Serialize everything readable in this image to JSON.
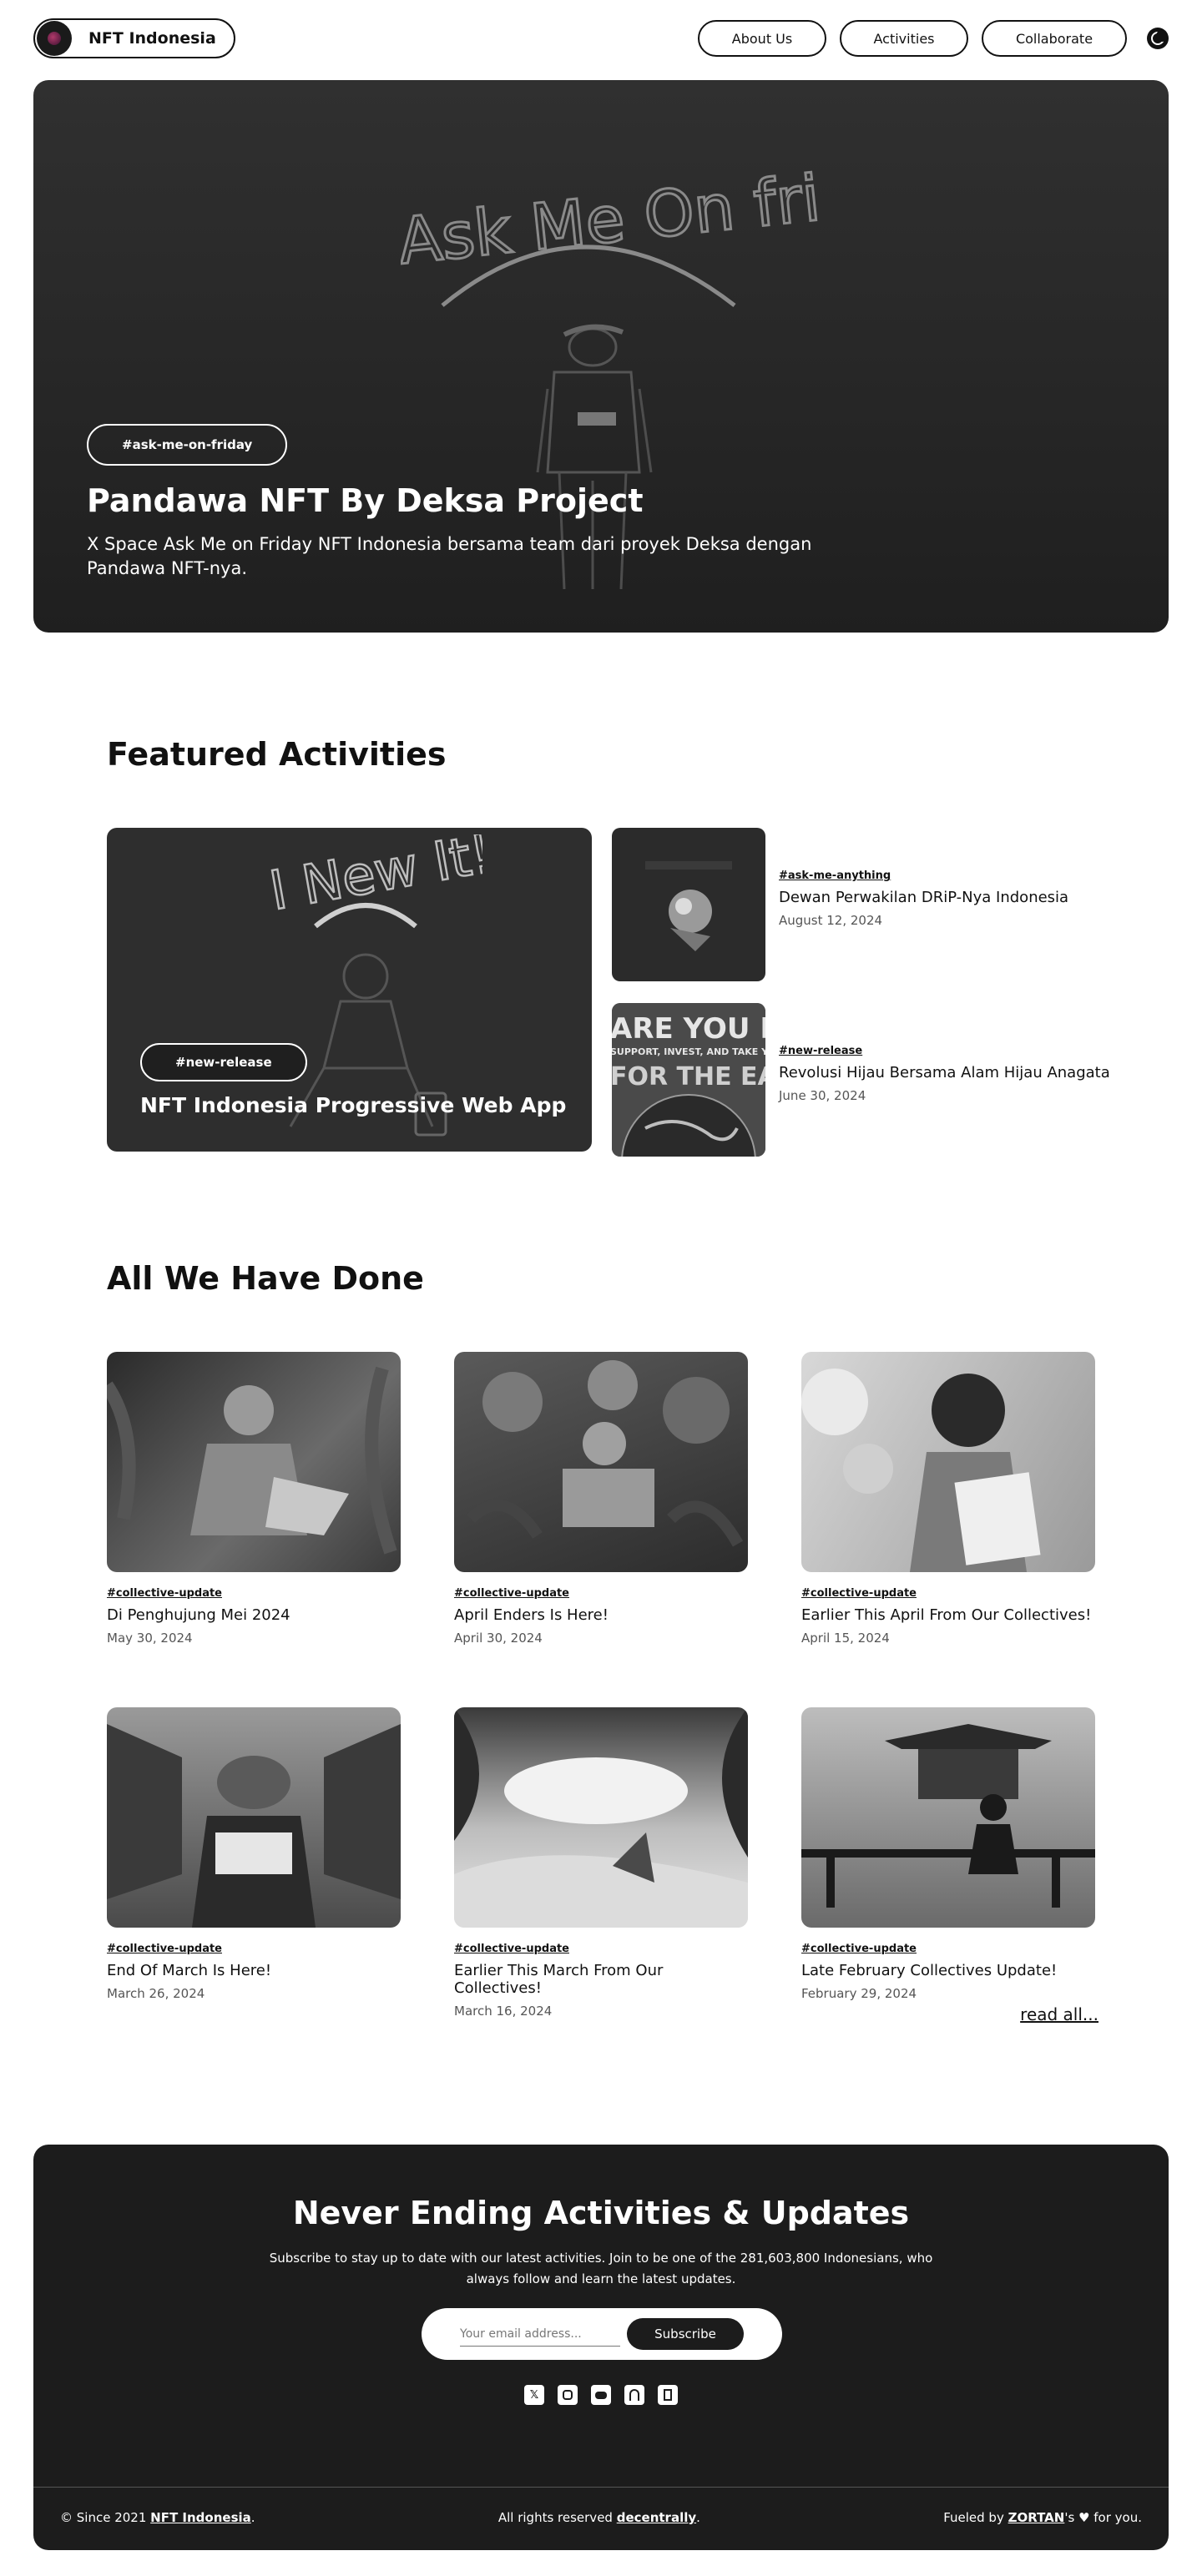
{
  "nav": {
    "brand": "NFT Indonesia",
    "links": [
      "About Us",
      "Activities",
      "Collaborate"
    ]
  },
  "hero": {
    "tag": "#ask-me-on-friday",
    "title": "Pandawa NFT By Deksa Project",
    "description": "X Space Ask Me on Friday NFT Indonesia bersama team dari proyek Deksa dengan Pandawa NFT-nya.",
    "art_text": "Ask Me On friday"
  },
  "featured": {
    "heading": "Featured Activities",
    "main": {
      "tag": "#new-release",
      "title": "NFT Indonesia Progressive Web App",
      "art_text": "I New It!"
    },
    "items": [
      {
        "tag": "#ask-me-anything",
        "title": "Dewan Perwakilan DRiP-Nya Indonesia",
        "date": "August 12, 2024"
      },
      {
        "tag": "#new-release",
        "title": "Revolusi Hijau Bersama Alam Hijau Anagata",
        "date": "June 30, 2024",
        "thumb_text": [
          "ARE YOU READY",
          "SUPPORT, INVEST, AND TAKE YOUR PA",
          "FOR THE EARTH"
        ]
      }
    ]
  },
  "done": {
    "heading": "All We Have Done",
    "cards": [
      {
        "tag": "#collective-update",
        "title": "Di Penghujung Mei 2024",
        "date": "May 30, 2024"
      },
      {
        "tag": "#collective-update",
        "title": "April Enders Is Here!",
        "date": "April 30, 2024"
      },
      {
        "tag": "#collective-update",
        "title": "Earlier This April From Our Collectives!",
        "date": "April 15, 2024"
      },
      {
        "tag": "#collective-update",
        "title": "End Of March Is Here!",
        "date": "March 26, 2024"
      },
      {
        "tag": "#collective-update",
        "title": "Earlier This March From Our Collectives!",
        "date": "March 16, 2024"
      },
      {
        "tag": "#collective-update",
        "title": "Late February Collectives Update!",
        "date": "February 29, 2024"
      }
    ],
    "read_all": "read all..."
  },
  "footer": {
    "title": "Never Ending Activities & Updates",
    "description": "Subscribe to stay up to date with our latest activities. Join to be one of the 281,603,800 Indonesians, who always follow and learn the latest updates.",
    "email_placeholder": "Your email address...",
    "subscribe": "Subscribe",
    "socials": [
      "x-icon",
      "instagram-icon",
      "discord-icon",
      "gitbook-icon",
      "notion-icon"
    ],
    "since_prefix": "© Since 2021 ",
    "since_link": "NFT Indonesia",
    "since_suffix": ".",
    "rights_prefix": "All rights reserved ",
    "rights_link": "decentrally",
    "rights_suffix": ".",
    "fueled_prefix": "Fueled by ",
    "fueled_link": "ZORTAN",
    "fueled_suffix": "'s ♥ for you."
  }
}
